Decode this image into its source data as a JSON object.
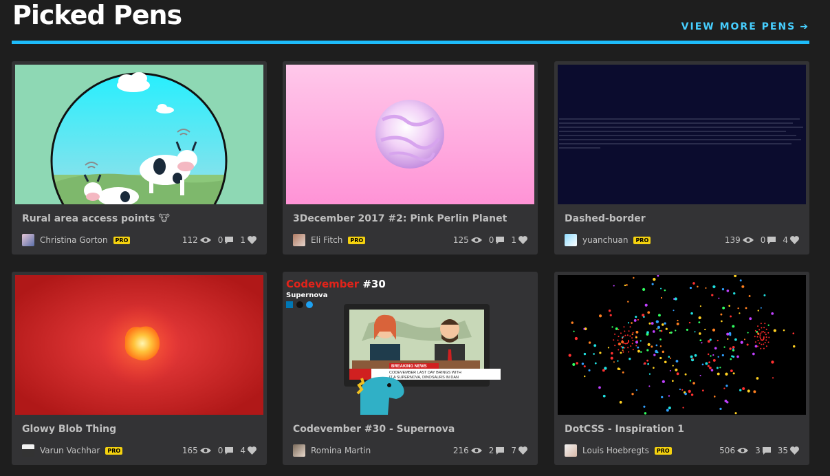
{
  "header": {
    "title": "Picked Pens",
    "view_more_label": "VIEW MORE PENS",
    "accent_color": "#1ebcfa"
  },
  "pens": [
    {
      "title": "Rural area access points 🐮",
      "author": "Christina Gorton",
      "pro": "PRO",
      "views": "112",
      "comments": "0",
      "loves": "1"
    },
    {
      "title": "3December 2017 #2: Pink Perlin Planet",
      "author": "Eli Fitch",
      "pro": "PRO",
      "views": "125",
      "comments": "0",
      "loves": "1"
    },
    {
      "title": "Dashed-border",
      "author": "yuanchuan",
      "pro": "PRO",
      "views": "139",
      "comments": "0",
      "loves": "4"
    },
    {
      "title": "Glowy Blob Thing",
      "author": "Varun Vachhar",
      "pro": "PRO",
      "views": "165",
      "comments": "0",
      "loves": "4"
    },
    {
      "title": "Codevember #30 - Supernova",
      "author": "Romina Martin",
      "pro": "",
      "views": "216",
      "comments": "2",
      "loves": "7"
    },
    {
      "title": "DotCSS - Inspiration 1",
      "author": "Louis Hoebregts",
      "pro": "PRO",
      "views": "506",
      "comments": "3",
      "loves": "35"
    }
  ],
  "thumb5": {
    "heading_red": "Codevember",
    "heading_white": "#30",
    "sub": "Supernova",
    "breaking": "BREAKING NEWS",
    "ticker1": "CODEVEMBER LAST DAY BRINGS WITH",
    "ticker2": "IT A SUPERNOVA, DINOSAURS IN DAN"
  }
}
